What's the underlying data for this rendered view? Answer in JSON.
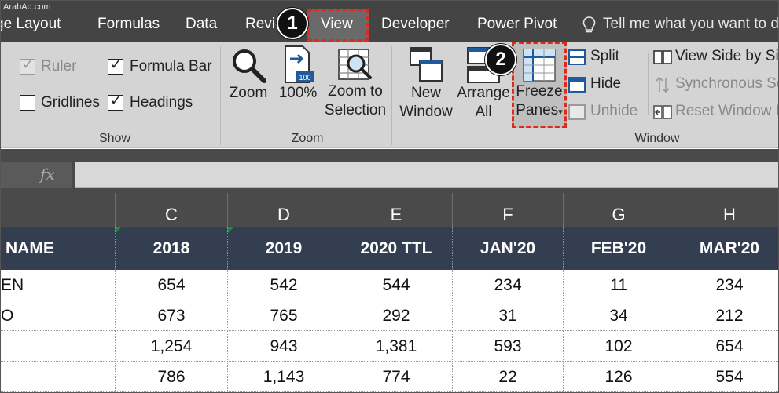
{
  "watermark": "ArabAq.com",
  "tabs": {
    "page_layout": "ge Layout",
    "formulas": "Formulas",
    "data": "Data",
    "review": "Revie",
    "view": "View",
    "developer": "Developer",
    "power_pivot": "Power Pivot",
    "tell_me": "Tell me what you want to d"
  },
  "badges": {
    "step1": "1",
    "step2": "2"
  },
  "show_group": {
    "label": "Show",
    "ruler": {
      "label": "Ruler",
      "checked": true,
      "disabled": true
    },
    "formula_bar": {
      "label": "Formula Bar",
      "checked": true
    },
    "gridlines": {
      "label": "Gridlines",
      "checked": false
    },
    "headings": {
      "label": "Headings",
      "checked": true
    }
  },
  "zoom_group": {
    "label": "Zoom",
    "zoom": "Zoom",
    "hundred": "100%",
    "hundred_badge": "100",
    "zoom_sel_line1": "Zoom to",
    "zoom_sel_line2": "Selection"
  },
  "window_group": {
    "label": "Window",
    "new_window_line1": "New",
    "new_window_line2": "Window",
    "arrange_line1": "Arrange",
    "arrange_line2": "All",
    "freeze_line1": "Freeze",
    "freeze_line2": "Panes",
    "split": "Split",
    "hide": "Hide",
    "unhide": "Unhide",
    "view_side": "View Side by Si",
    "sync_scroll": "Synchronous Sc",
    "reset_window": "Reset Window P"
  },
  "formula_bar": {
    "fx": "fx",
    "value": ""
  },
  "columns": [
    "C",
    "D",
    "E",
    "F",
    "G",
    "H"
  ],
  "table_headers": [
    "NAME",
    "2018",
    "2019",
    "2020 TTL",
    "JAN'20",
    "FEB'20",
    "MAR'20"
  ],
  "rows": [
    [
      "EN",
      "654",
      "542",
      "544",
      "234",
      "11",
      "234"
    ],
    [
      "O",
      "673",
      "765",
      "292",
      "31",
      "34",
      "212"
    ],
    [
      "",
      "1,254",
      "943",
      "1,381",
      "593",
      "102",
      "654"
    ],
    [
      "",
      "786",
      "1,143",
      "774",
      "22",
      "126",
      "554"
    ]
  ],
  "colors": {
    "ribbon_tab_bg": "#444444",
    "ribbon_bg": "#d4d4d4",
    "header_row_bg": "#333e50",
    "highlight_red": "#e0281d"
  }
}
